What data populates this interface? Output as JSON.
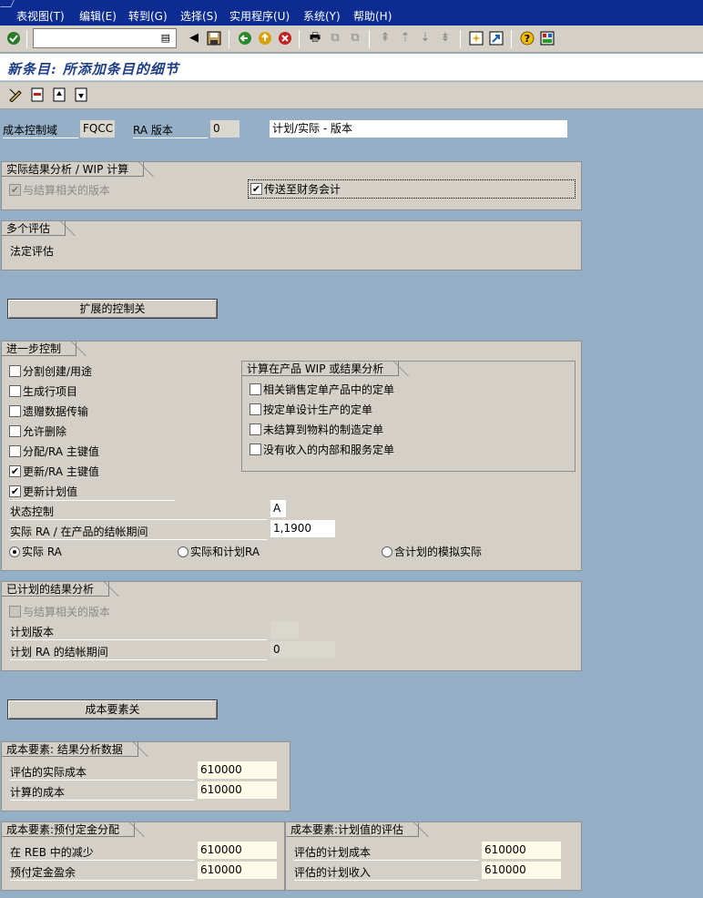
{
  "menu": [
    "表视图(T)",
    "编辑(E)",
    "转到(G)",
    "选择(S)",
    "实用程序(U)",
    "系统(Y)",
    "帮助(H)"
  ],
  "page_title": "新条目: 所添加条目的细节",
  "header": {
    "cost_ctrl_area_label": "成本控制域",
    "cost_ctrl_area_value": "FQCC",
    "ra_version_label": "RA 版本",
    "ra_version_value": "0",
    "version_desc": "计划/实际 - 版本"
  },
  "actual_ra": {
    "title": "实际结果分析 / WIP 计算",
    "cb_related_version": "与结算相关的版本",
    "cb_transfer_fi": "传送至财务会计"
  },
  "multi_val": {
    "title": "多个评估",
    "legal_val": "法定评估"
  },
  "btn_ext_controls": "扩展的控制关",
  "further": {
    "title": "进一步控制",
    "checkboxes": [
      "分割创建/用途",
      "生成行项目",
      "遗赠数据传输",
      "允许删除",
      "分配/RA 主键值",
      "更新/RA 主键值",
      "更新计划值"
    ],
    "checked": [
      false,
      false,
      false,
      false,
      false,
      true,
      true
    ],
    "status_ctrl_label": "状态控制",
    "status_ctrl_value": "A",
    "period_label": "实际 RA / 在产品的结帐期间",
    "period_value": "1,1900",
    "radio_actual": "实际 RA",
    "radio_actual_plan": "实际和计划RA",
    "radio_sim": "含计划的模拟实际",
    "wip_group": {
      "title": "计算在产品 WIP 或结果分析",
      "items": [
        "相关销售定单产品中的定单",
        "按定单设计生产的定单",
        "未结算到物料的制造定单",
        "没有收入的内部和服务定单"
      ]
    }
  },
  "planned": {
    "title": "已计划的结果分析",
    "cb_related_version": "与结算相关的版本",
    "plan_version_label": "计划版本",
    "plan_version_value": "",
    "period_label": "计划 RA 的结帐期间",
    "period_value": "0"
  },
  "btn_cost_elements": "成本要素关",
  "ce_ra": {
    "title": "成本要素: 结果分析数据",
    "rows": [
      {
        "label": "评估的实际成本",
        "value": "610000"
      },
      {
        "label": "计算的成本",
        "value": "610000"
      }
    ]
  },
  "ce_prepay": {
    "title": "成本要素:预付定金分配",
    "rows": [
      {
        "label": "在 REB 中的减少",
        "value": "610000"
      },
      {
        "label": "预付定金盈余",
        "value": "610000"
      }
    ]
  },
  "ce_plan": {
    "title": "成本要素:计划值的评估",
    "rows": [
      {
        "label": "评估的计划成本",
        "value": "610000"
      },
      {
        "label": "评估的计划收入",
        "value": "610000"
      }
    ]
  }
}
